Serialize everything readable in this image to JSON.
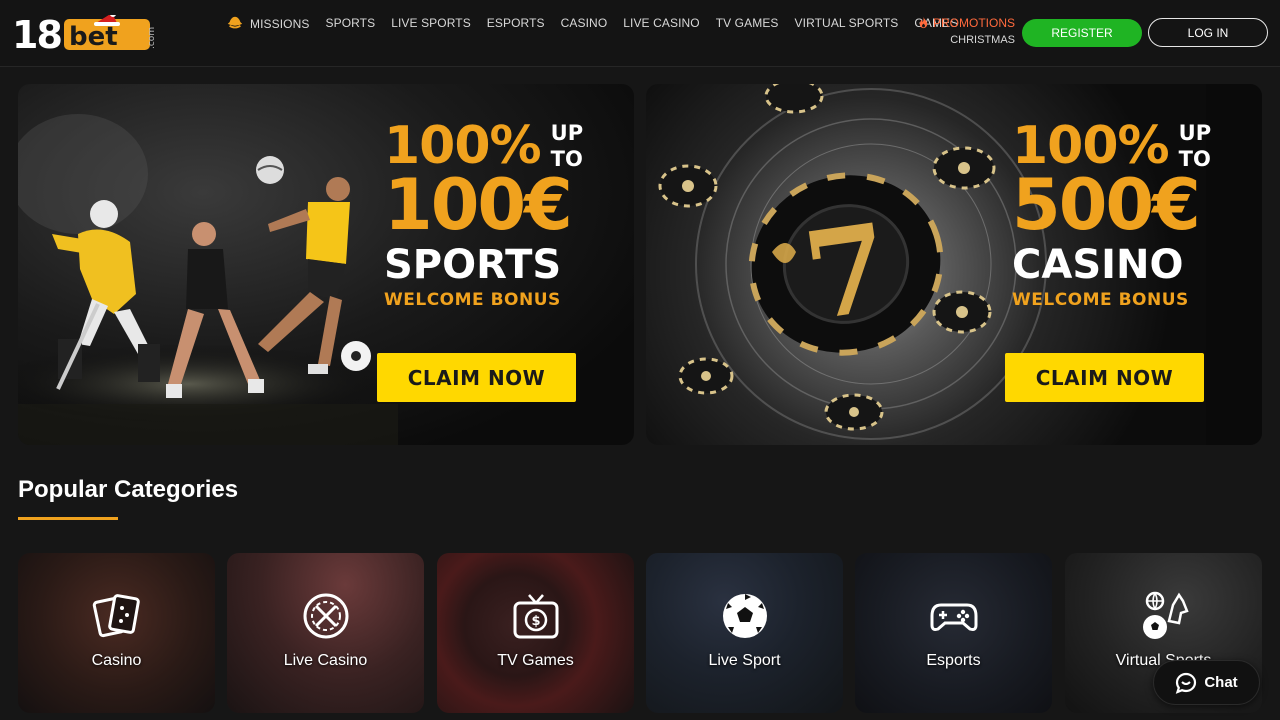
{
  "header": {
    "logo_text": "18bet",
    "logo_suffix": ".com",
    "nav": [
      {
        "label": "Missions",
        "icon": "missions-hat-icon"
      },
      {
        "label": "Sports"
      },
      {
        "label": "Live Sports"
      },
      {
        "label": "Esports"
      },
      {
        "label": "Casino"
      },
      {
        "label": "Live Casino"
      },
      {
        "label": "TV Games"
      },
      {
        "label": "Virtual Sports"
      },
      {
        "label": "Games"
      }
    ],
    "promotions_label": "Promotions",
    "promotions_sub": "Christmas",
    "register_label": "Register",
    "login_label": "Log In"
  },
  "banners": [
    {
      "percent": "100%",
      "upto": "UP TO",
      "amount": "100€",
      "kind": "SPORTS",
      "bonus": "WELCOME BONUS",
      "cta": "CLAIM NOW"
    },
    {
      "percent": "100%",
      "upto": "UP TO",
      "amount": "500€",
      "kind": "CASINO",
      "bonus": "WELCOME BONUS",
      "cta": "CLAIM NOW"
    }
  ],
  "popular": {
    "title": "Popular Categories",
    "categories": [
      {
        "label": "Casino",
        "icon": "cards-icon"
      },
      {
        "label": "Live Casino",
        "icon": "roulette-icon"
      },
      {
        "label": "TV Games",
        "icon": "tv-icon"
      },
      {
        "label": "Live Sport",
        "icon": "soccer-ball-icon"
      },
      {
        "label": "Esports",
        "icon": "gamepad-icon"
      },
      {
        "label": "Virtual Sports",
        "icon": "virtual-sports-icon"
      }
    ]
  },
  "chat": {
    "label": "Chat"
  },
  "colors": {
    "accent": "#f0a21e",
    "register": "#1fb423",
    "cta": "#ffd800",
    "promo": "#ff6a3d"
  }
}
